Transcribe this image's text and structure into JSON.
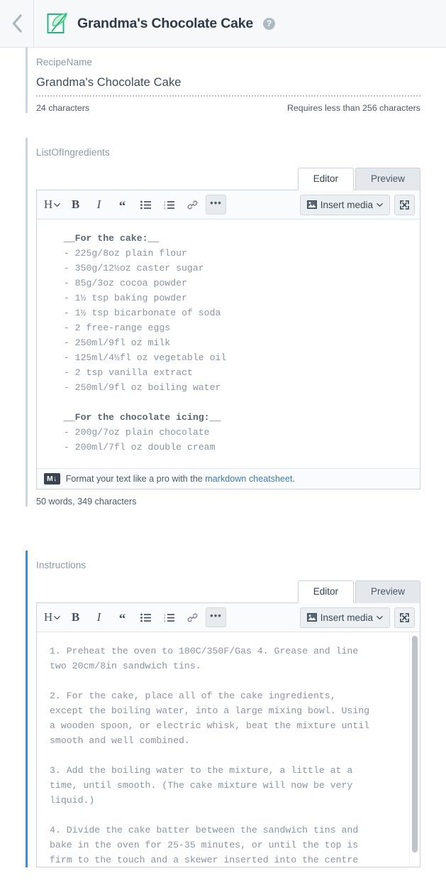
{
  "header": {
    "back_label": "‹",
    "doc_icon": "leaf-document-icon",
    "title": "Grandma's Chocolate Cake",
    "help_glyph": "?"
  },
  "fields": [
    {
      "label": "RecipeName",
      "value": "Grandma's Chocolate Cake",
      "char_count": "24 characters",
      "requirement": "Requires less than 256 characters",
      "focused": false
    }
  ],
  "editor_common": {
    "tabs": {
      "editor": "Editor",
      "preview": "Preview",
      "active": "Editor"
    },
    "toolbar": {
      "heading": "H",
      "heading_caret": "⌄",
      "bold": "B",
      "italic": "I",
      "quote": "“",
      "bullet_list": "bullet-list-icon",
      "numbered_list": "numbered-list-icon",
      "link": "link-icon",
      "more": "•••",
      "insert_media": "Insert media",
      "insert_media_caret": "⌄",
      "fullscreen": "expand-icon"
    },
    "footer": {
      "badge": "M↓",
      "text_before": "Format your text like a pro with the ",
      "link": "markdown cheatsheet",
      "text_after": "."
    }
  },
  "ingredients_field": {
    "label": "ListOfIngredients",
    "focused": false,
    "content": "  __For the cake:__\n  - 225g/8oz plain flour\n  - 350g/12½oz caster sugar\n  - 85g/3oz cocoa powder\n  - 1½ tsp baking powder\n  - 1½ tsp bicarbonate of soda\n  - 2 free-range eggs\n  - 250ml/9fl oz milk\n  - 125ml/4½fl oz vegetable oil\n  - 2 tsp vanilla extract\n  - 250ml/9fl oz boiling water\n\n  __For the chocolate icing:__\n  - 200g/7oz plain chocolate\n  - 200ml/7fl oz double cream",
    "heading_1": "  __For the cake:__",
    "items_1": [
      "  - 225g/8oz plain flour",
      "  - 350g/12½oz caster sugar",
      "  - 85g/3oz cocoa powder",
      "  - 1½ tsp baking powder",
      "  - 1½ tsp bicarbonate of soda",
      "  - 2 free-range eggs",
      "  - 250ml/9fl oz milk",
      "  - 125ml/4½fl oz vegetable oil",
      "  - 2 tsp vanilla extract",
      "  - 250ml/9fl oz boiling water"
    ],
    "heading_2": "  __For the chocolate icing:__",
    "items_2": [
      "  - 200g/7oz plain chocolate",
      "  - 200ml/7fl oz double cream"
    ],
    "count": "50 words, 349 characters"
  },
  "instructions_field": {
    "label": "Instructions",
    "focused": true,
    "content": "1. Preheat the oven to 180C/350F/Gas 4. Grease and line\ntwo 20cm/8in sandwich tins.\n\n2. For the cake, place all of the cake ingredients,\nexcept the boiling water, into a large mixing bowl. Using\na wooden spoon, or electric whisk, beat the mixture until\nsmooth and well combined.\n\n3. Add the boiling water to the mixture, a little at a\ntime, until smooth. (The cake mixture will now be very\nliquid.)\n\n4. Divide the cake batter between the sandwich tins and\nbake in the oven for 25-35 minutes, or until the top is\nfirm to the touch and a skewer inserted into the centre\nof the cake comes out clean."
  },
  "colors": {
    "accent_focus": "#3d8ddd",
    "accent_idle": "#ced6dd",
    "brand_green": "#20b873",
    "link": "#3a7bbd",
    "code_text": "#8a95a1"
  }
}
